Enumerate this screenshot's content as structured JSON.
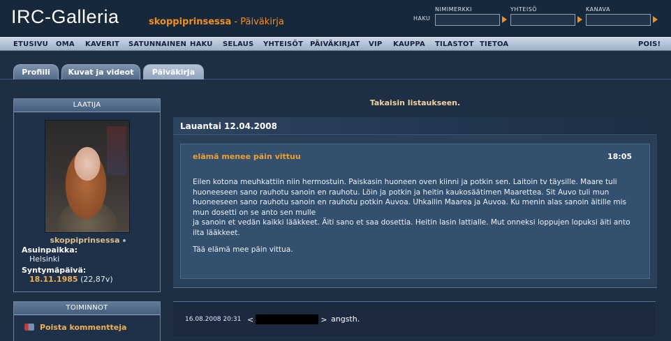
{
  "header": {
    "logo": "IRC-Galleria",
    "username": "skoppiprinsessa",
    "separator": " - ",
    "section": "Päiväkirja",
    "search_label": "HAKU",
    "search_fields": [
      {
        "label": "NIMIMERKKI"
      },
      {
        "label": "YHTEISÖ"
      },
      {
        "label": "KANAVA"
      }
    ]
  },
  "nav": {
    "items": [
      "ETUSIVU",
      "OMA",
      "KAVERIT",
      "SATUNNAINEN",
      "HAKU",
      "SELAUS",
      "YHTEISÖT",
      "PÄIVÄKIRJAT",
      "VIP",
      "KAUPPA",
      "TILASTOT",
      "TIETOA"
    ],
    "logout": "POIS!"
  },
  "tabs": [
    {
      "label": "Profiili"
    },
    {
      "label": "Kuvat ja videot"
    },
    {
      "label": "Päiväkirja"
    }
  ],
  "creator_box": {
    "title": "LAATIJA",
    "name": "skoppiprinsessa",
    "location_label": "Asuinpaikka:",
    "location": "Helsinki",
    "birthday_label": "Syntymäpäivä:",
    "birthday_date": "18.11.1985",
    "age": " (22,87v)"
  },
  "actions_box": {
    "title": "TOIMINNOT",
    "delete_comments": "Poista kommentteja"
  },
  "main": {
    "back_link": "Takaisin listaukseen.",
    "date": "Lauantai 12.04.2008",
    "entry": {
      "title": "elämä menee päin vittuu",
      "time": "18:05",
      "paragraph1_line1": "Eilen kotona meuhkattiin niin hermostuin. Paiskasin huoneen oven kiinni ja potkin sen. Laitoin tv täysille. Maare tuli huoneeseen sano rauhotu sanoin en rauhotu. Löin ja potkin ja heitin kaukosäätimen Maarettea. Sit Auvo tuli mun huoneeseen sano rauhotu sanoin en rauhotu potkin Auvoa. Uhkailin Maarea ja Auvoa. Ku menin alas sanoin äitille mis mun dosetti on se anto sen mulle",
      "paragraph1_line2": "ja sanoin et vedän kaikki lääkkeet. Äiti sano et saa dosettia. Heitin lasin lattialle. Mut onneksi loppujen lopuksi äiti anto ilta lääkkeet.",
      "paragraph2": "Tää elämä mee päin vittua."
    },
    "comment": {
      "date": "16.08.2008 20:31",
      "open_bracket": "<",
      "close_bracket": ">",
      "text": "angsth."
    }
  }
}
